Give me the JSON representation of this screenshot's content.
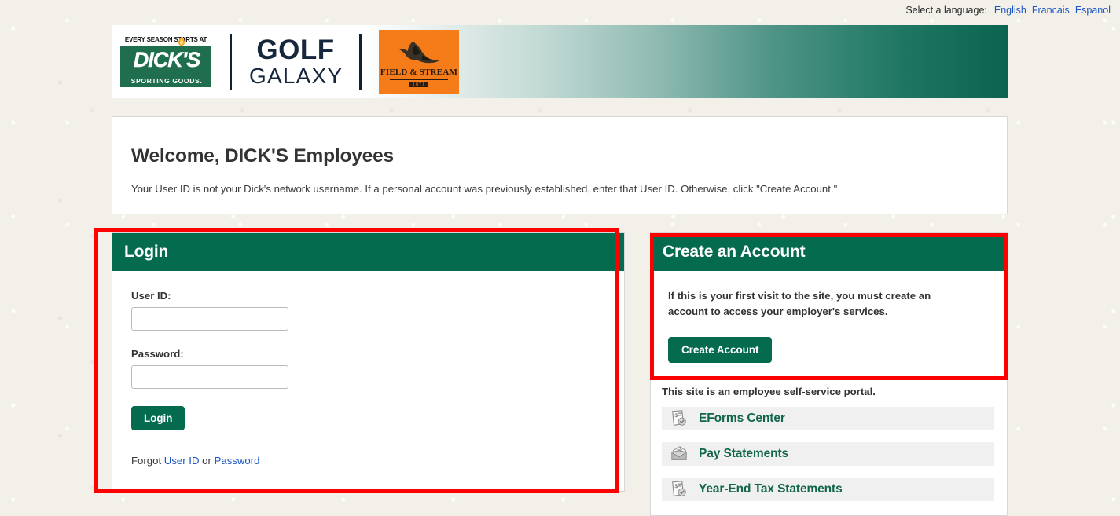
{
  "language_bar": {
    "label": "Select a language:",
    "options": [
      {
        "name": "english",
        "label": "English"
      },
      {
        "name": "francais",
        "label": "Francais"
      },
      {
        "name": "espanol",
        "label": "Espanol"
      }
    ]
  },
  "brand_header": {
    "dicks": {
      "tagline": "EVERY SEASON STARTS AT",
      "name": "DICK'S",
      "subtitle": "SPORTING GOODS.",
      "green": "#1f6f4f"
    },
    "golf_galaxy": {
      "line1": "GOLF",
      "line2": "GALAXY",
      "navy": "#16263c"
    },
    "field_and_stream": {
      "name": "FIELD & STREAM",
      "year": "1871",
      "orange": "#f57c18"
    },
    "gradient_end_color": "#0a6450"
  },
  "welcome": {
    "title": "Welcome, DICK'S Employees",
    "description": "Your User ID is not your Dick's network username. If a personal account was previously established, enter that User ID. Otherwise, click \"Create Account.\""
  },
  "login": {
    "header": "Login",
    "user_id_label": "User ID:",
    "user_id_value": "",
    "user_id_placeholder": "",
    "password_label": "Password:",
    "password_value": "",
    "password_placeholder": "",
    "submit_label": "Login",
    "forgot_prefix": "Forgot",
    "forgot_user_id": "User ID",
    "forgot_separator": "or",
    "forgot_password": "Password"
  },
  "create_account": {
    "header": "Create an Account",
    "description": "If this is your first visit to the site, you must create an account to access your employer's services.",
    "button_label": "Create Account"
  },
  "portal": {
    "note": "This site is an employee self-service portal.",
    "services": [
      {
        "icon": "document-dollar-check-icon",
        "label": "EForms Center"
      },
      {
        "icon": "envelope-dollar-icon",
        "label": "Pay Statements"
      },
      {
        "icon": "document-dollar-check-icon",
        "label": "Year-End Tax Statements"
      }
    ]
  },
  "theme": {
    "primary_green": "#046b4f",
    "link_blue": "#1a56c4",
    "service_link_green": "#11654b",
    "annotation_red": "#fd0000",
    "page_background": "#f3f0ea"
  }
}
